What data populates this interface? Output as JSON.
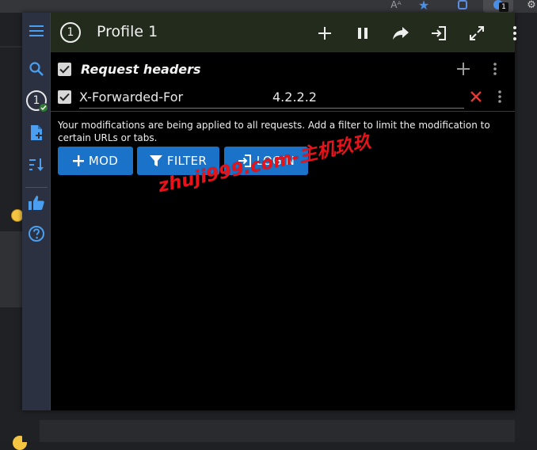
{
  "browser": {
    "toolbar_font_label": "Aᴬ",
    "extension_badge": "1"
  },
  "header": {
    "profile_number": "1",
    "profile_title": "Profile 1"
  },
  "sidebar": {
    "active_profile_number": "1"
  },
  "request_headers": {
    "section_title": "Request headers",
    "enabled": true,
    "rows": [
      {
        "enabled": true,
        "name": "X-Forwarded-For",
        "value": "4.2.2.2"
      }
    ]
  },
  "message": "Your modifications are being applied to all requests. Add a filter to limit the modification to certain URLs or tabs.",
  "buttons": {
    "mod_label": "MOD",
    "filter_label": "FILTER",
    "login_label": "LOGIN"
  },
  "watermark": "zhuji999.com-主机玖玖",
  "colors": {
    "accent_blue": "#1a73c8",
    "sidebar_bg": "#2b3140",
    "header_bg": "#232b1d",
    "delete_red": "#e53935",
    "watermark_red": "#e8121a"
  }
}
